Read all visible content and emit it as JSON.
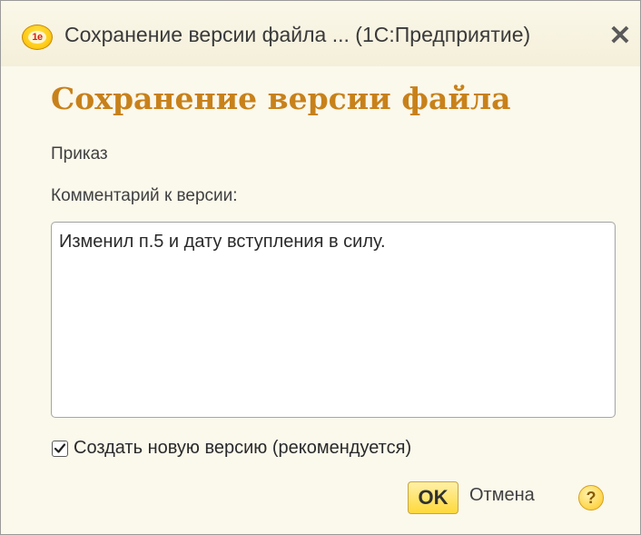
{
  "window": {
    "title": "Сохранение версии файла ...  (1С:Предприятие)",
    "app_icon": "1c-logo-icon",
    "app_icon_text": "1e",
    "close_icon": "close-icon",
    "close_glyph": "✕"
  },
  "form": {
    "heading": "Сохранение версии файла",
    "file_name": "Приказ",
    "comment_label": "Комментарий к версии:",
    "comment_value": "Изменил п.5 и дату вступления в силу.",
    "create_new_version": {
      "label": "Создать новую версию (рекомендуется)",
      "checked": true
    }
  },
  "buttons": {
    "ok_label": "OK",
    "cancel_label": "Отмена",
    "help_glyph": "?",
    "help_icon": "help-icon"
  },
  "colors": {
    "heading": "#c8811a",
    "window_background": "#fbf8ec",
    "ok_button": "#ffd93a"
  }
}
